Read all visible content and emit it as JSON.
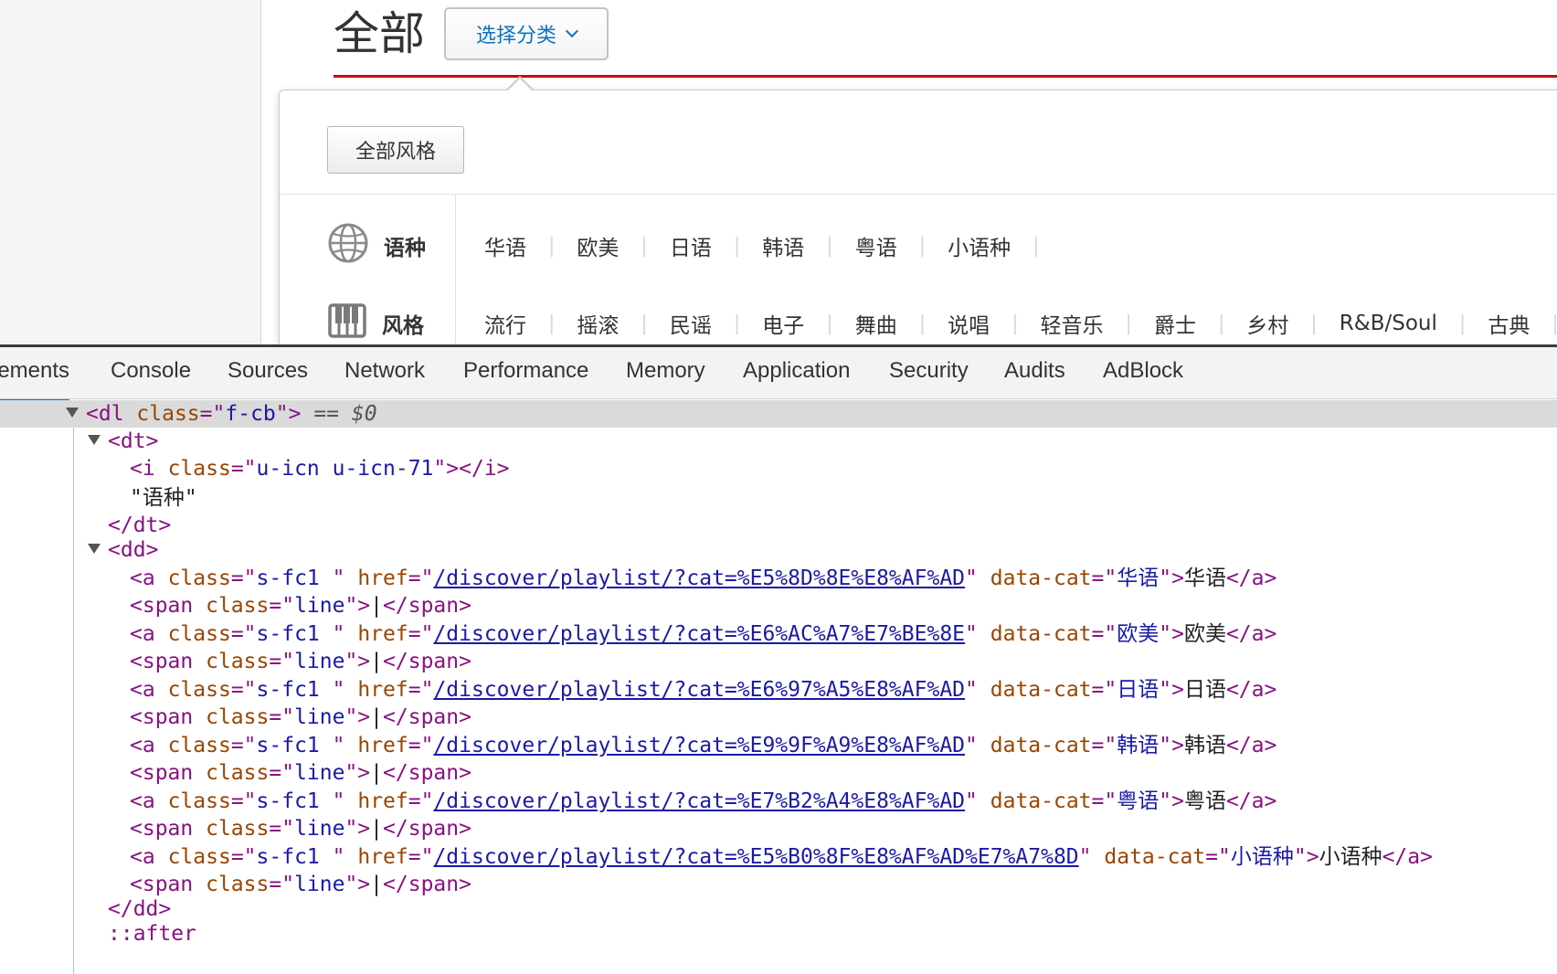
{
  "page": {
    "title": "全部",
    "category_button_label": "选择分类",
    "all_styles_button_label": "全部风格",
    "rows": [
      {
        "icon": "globe-icon",
        "label": "语种",
        "tags": [
          "华语",
          "欧美",
          "日语",
          "韩语",
          "粤语",
          "小语种"
        ]
      },
      {
        "icon": "piano-icon",
        "label": "风格",
        "tags": [
          "流行",
          "摇滚",
          "民谣",
          "电子",
          "舞曲",
          "说唱",
          "轻音乐",
          "爵士",
          "乡村",
          "R&B/Soul",
          "古典"
        ]
      }
    ],
    "separator": "|",
    "colors": {
      "accent_red": "#c20c0c",
      "link_blue": "#0c73c2"
    }
  },
  "devtools": {
    "tabs": [
      "lements",
      "Console",
      "Sources",
      "Network",
      "Performance",
      "Memory",
      "Application",
      "Security",
      "Audits",
      "AdBlock"
    ],
    "active_tab": "lements",
    "code": {
      "dl_tag": "dl",
      "dl_class_attr": "class",
      "dl_class_value": "f-cb",
      "selected_marker": "== $0",
      "dt_tag": "dt",
      "i_tag": "i",
      "i_class_value": "u-icn u-icn-71",
      "dt_text": "\"语种\"",
      "dd_tag": "dd",
      "a_tag": "a",
      "a_class_value": "s-fc1 ",
      "href_attr": "href",
      "data_cat_attr": "data-cat",
      "span_tag": "span",
      "span_class_value": "line",
      "span_text": "|",
      "after_pseudo": "::after",
      "links": [
        {
          "href": "/discover/playlist/?cat=%E5%8D%8E%E8%AF%AD",
          "cat": "华语",
          "text": "华语"
        },
        {
          "href": "/discover/playlist/?cat=%E6%AC%A7%E7%BE%8E",
          "cat": "欧美",
          "text": "欧美"
        },
        {
          "href": "/discover/playlist/?cat=%E6%97%A5%E8%AF%AD",
          "cat": "日语",
          "text": "日语"
        },
        {
          "href": "/discover/playlist/?cat=%E9%9F%A9%E8%AF%AD",
          "cat": "韩语",
          "text": "韩语"
        },
        {
          "href": "/discover/playlist/?cat=%E7%B2%A4%E8%AF%AD",
          "cat": "粤语",
          "text": "粤语"
        },
        {
          "href": "/discover/playlist/?cat=%E5%B0%8F%E8%AF%AD%E7%A7%8D",
          "cat": "小语种",
          "text": "小语种"
        }
      ]
    }
  }
}
